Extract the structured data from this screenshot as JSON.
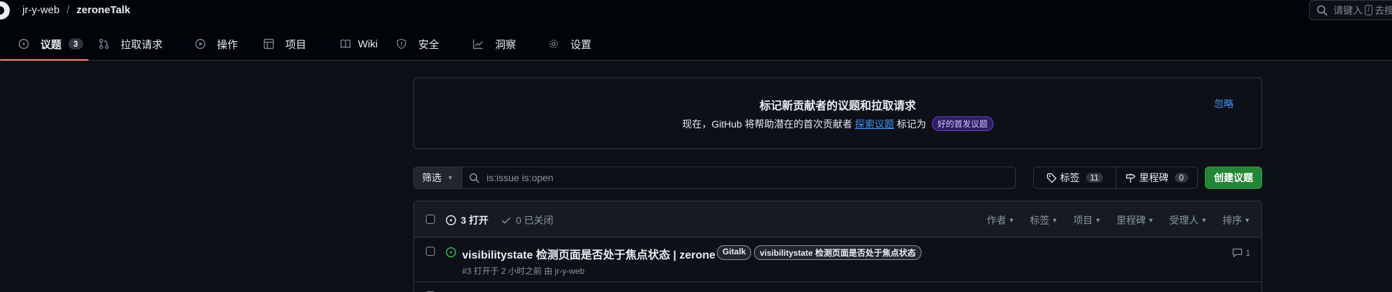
{
  "header": {
    "owner": "jr-y-web",
    "separator": "/",
    "repo": "zeroneTalk",
    "search": {
      "placeholder_before": "请键入",
      "kbd": "/",
      "placeholder_after": "去搜"
    }
  },
  "tabs": [
    {
      "label": "议题",
      "icon": "issue-opened-icon",
      "count": "3",
      "active": true
    },
    {
      "label": "拉取请求",
      "icon": "git-pull-request-icon"
    },
    {
      "label": "操作",
      "icon": "play-icon"
    },
    {
      "label": "项目",
      "icon": "table-icon"
    },
    {
      "label": "Wiki",
      "icon": "book-icon"
    },
    {
      "label": "安全",
      "icon": "shield-icon"
    },
    {
      "label": "洞察",
      "icon": "graph-icon"
    },
    {
      "label": "设置",
      "icon": "gear-icon"
    }
  ],
  "banner": {
    "title": "标记新贡献者的议题和拉取请求",
    "text_before": "现在，GitHub 将帮助潜在的首次贡献者",
    "link": "探索议题",
    "text_after": "标记为",
    "label": "好的首发议题",
    "dismiss": "忽略"
  },
  "filters": {
    "filter_button": "筛选",
    "search_value": "is:issue is:open",
    "labels_button": "标签",
    "labels_count": "11",
    "milestones_button": "里程碑",
    "milestones_count": "0",
    "new_issue": "创建议题"
  },
  "issues_header": {
    "open_label": "3 打开",
    "closed_label": "0 已关闭",
    "sort_menus": [
      "作者",
      "标签",
      "项目",
      "里程碑",
      "受理人",
      "排序"
    ]
  },
  "issues": [
    {
      "title": "visibilitystate 检测页面是否处于焦点状态 | zerone",
      "labels": [
        "Gitalk",
        "visibilitystate 检测页面是否处于焦点状态"
      ],
      "meta": "#3 打开于 2 小时之前 由 jr-y-web",
      "comments": "1"
    }
  ],
  "colors": {
    "background": "#0d1117",
    "header_bg": "#010409",
    "border": "#30363d",
    "accent_underline": "#fd8c73",
    "link": "#4493f8",
    "open_green": "#3fb950",
    "primary_button": "#238636"
  }
}
